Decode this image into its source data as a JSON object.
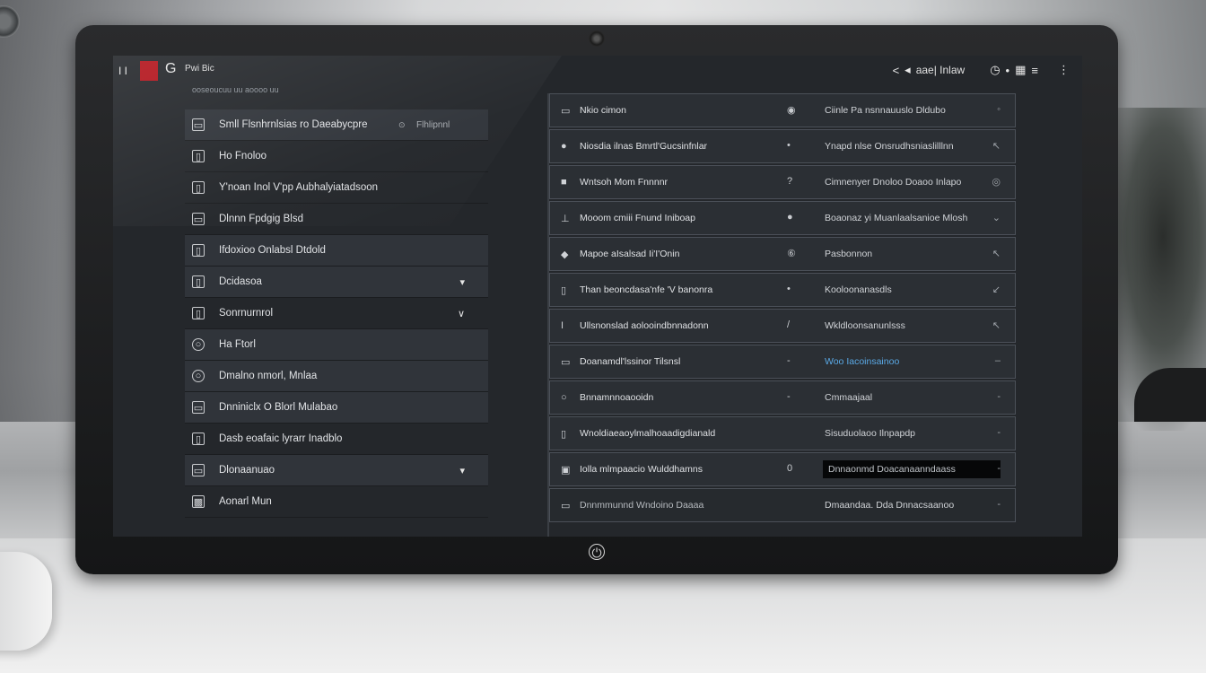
{
  "topbar": {
    "pause_glyph": "I I",
    "back_glyph": "G",
    "title": "Pwi Bic",
    "subtitle": "ooseoucuu uu aoooo uu",
    "nav_left": "<",
    "nav_sep": "◂",
    "label": "aae| Inlaw",
    "icon_clock": "◷",
    "icon_dot": "•",
    "icon_grid": "▦",
    "icon_menu": "≡",
    "icon_more": "⋮"
  },
  "menu": {
    "items": [
      {
        "label": "Smll Flsnhrnlsias ro Daeabycpre",
        "icon": "▭",
        "extra": "Flhlipnnl",
        "extra_icon": "⊙",
        "shaded": true
      },
      {
        "label": "Ho Fnoloo",
        "icon": "▯"
      },
      {
        "label": "Y'noan Inol V'pp Aubhalyiatadsoon",
        "icon": "▯"
      },
      {
        "label": "Dlnnn Fpdgig Blsd",
        "icon": "▭"
      },
      {
        "label": "Ifdoxioo Onlabsl Dtdold",
        "icon": "▯",
        "shaded": true
      },
      {
        "label": "Dcidasoa",
        "icon": "▯",
        "chev": "▾",
        "shaded": true
      },
      {
        "label": "Sonrnurnrol",
        "icon": "▯",
        "chev": "∨"
      },
      {
        "label": "Ha Ftorl",
        "icon": "○",
        "round": true,
        "shaded": true
      },
      {
        "label": "Dmalno nmorl, Mnlaa",
        "icon": "○",
        "round": true,
        "shaded": true
      },
      {
        "label": "Dnniniclx O Blorl Mulabao",
        "icon": "▭",
        "shaded": true
      },
      {
        "label": "Dasb eoafaic lyrarr Inadblo",
        "icon": "▯"
      },
      {
        "label": "Dlonaanuao",
        "icon": "▭",
        "chev": "▾",
        "shaded": true
      },
      {
        "label": "Aonarl Mun",
        "icon": "▩"
      }
    ]
  },
  "grid": {
    "rows": [
      {
        "icon": "▭",
        "label": "Nkio cimon",
        "mid": "◉",
        "value": "Ciinle Pa nsnnauuslo Dldubo",
        "end": "◦"
      },
      {
        "icon": "●",
        "label": "Niosdia ilnas Bmrtl'Gucsinfnlar",
        "mid": "•",
        "value": "Ynapd nlse Onsrudhsniaslilllnn",
        "end": "↖"
      },
      {
        "icon": "■",
        "label": "Wntsoh Mom Fnnnnr",
        "mid": "?",
        "value": "Cimnenyer Dnoloo Doaoo Inlapo",
        "end": "◎"
      },
      {
        "icon": "⊥",
        "label": "Mooom cmiii Fnund Iniboap",
        "mid": "●",
        "value": "Boaonaz yi Muanlaalsanioe Mlosh",
        "end": "⌄"
      },
      {
        "icon": "◆",
        "label": "Mapoe aIsalsad Ii'I'Onin",
        "mid": "⑥",
        "value": "Pasbonnon",
        "end": "↖"
      },
      {
        "icon": "▯",
        "label": "Than beoncdasa'nfe 'V banonra",
        "mid": "•",
        "value": "Kooloonanasdls",
        "end": "↙"
      },
      {
        "icon": "I",
        "label": "Ullsnonslad aolooindbnnadonn",
        "mid": "/",
        "value": "Wkldloonsanunlsss",
        "end": "↖"
      },
      {
        "icon": "▭",
        "label": "Doanamdl'lssinor Tilsnsl",
        "mid": "-",
        "value": "Woo Iacoinsainoo",
        "value_style": "link",
        "end": "‒"
      },
      {
        "icon": "○",
        "label": "Bnnamnnoaooidn",
        "mid": "-",
        "value": "Cmmaajaal",
        "end": "-"
      },
      {
        "icon": "▯",
        "label": "Wnoldiaeaoylmalhoaadigdianald",
        "mid": "",
        "value": "Sisuduolaoo Ilnpapdp",
        "end": "-"
      },
      {
        "icon": "▣",
        "label": "Iolla mlmpaacio Wulddhamns",
        "mid": "0",
        "value": "Dnnaonmd Doacanaanndaass",
        "value_style": "boxed",
        "end": "-"
      },
      {
        "icon": "▭",
        "label": "Dnnmmunnd Wndoino Daaaa",
        "mid": "",
        "value": "Dmaandaa. Dda Dnnacsaanoo",
        "end": "-",
        "faded": true
      }
    ]
  }
}
